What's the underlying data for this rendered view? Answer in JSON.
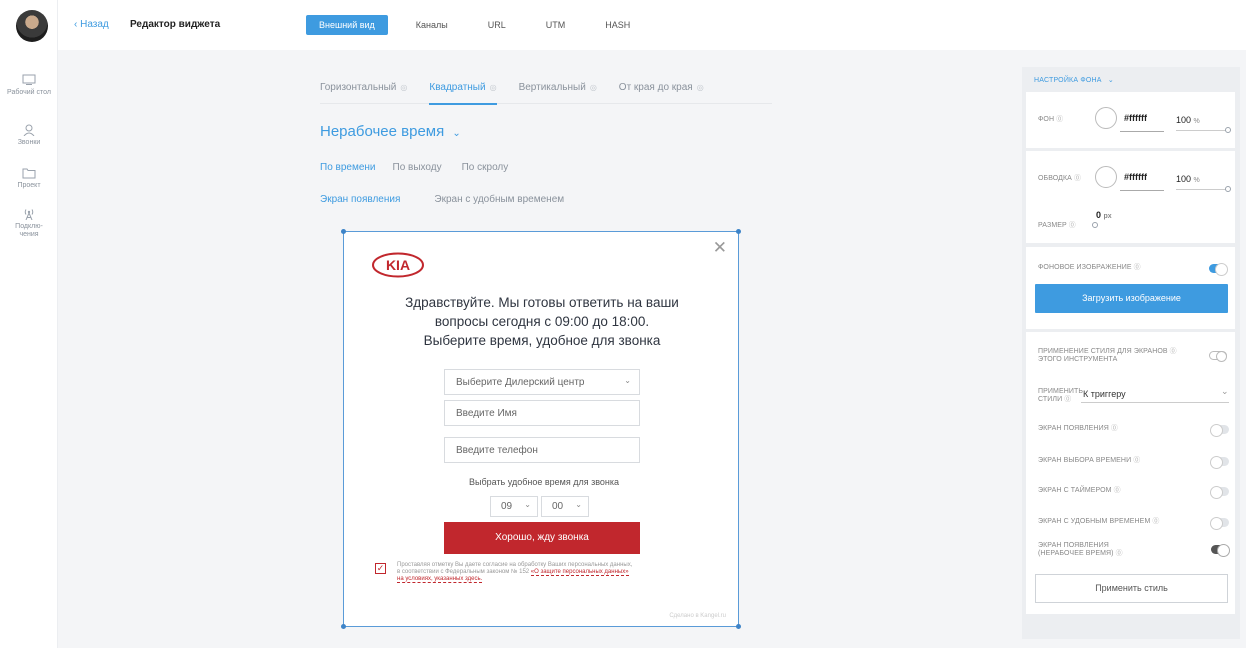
{
  "sidebar": {
    "items": [
      {
        "label": "Рабочий стол",
        "icon": "desktop-icon"
      },
      {
        "label": "Звонки",
        "icon": "person-icon"
      },
      {
        "label": "Проект",
        "icon": "folder-icon"
      },
      {
        "label": "Подклю-чения",
        "icon": "antenna-icon"
      }
    ]
  },
  "topbar": {
    "back": "‹ Назад",
    "title": "Редактор виджета",
    "tabs": [
      "Внешний вид",
      "Каналы",
      "URL",
      "UTM",
      "HASH"
    ]
  },
  "main": {
    "size_tabs": [
      "Горизонтальный",
      "Квадратный",
      "Вертикальный",
      "От края до края"
    ],
    "screen_title": "Нерабочее время",
    "trigger_tabs": [
      "По времени",
      "По выходу",
      "По скролу"
    ],
    "screen_tabs": [
      "Экран появления",
      "Экран с удобным временем"
    ]
  },
  "widget": {
    "brand_logo": "KIA",
    "headline_1": "Здравствуйте. Мы готовы ответить на ваши",
    "headline_2": "вопросы сегодня с 09:00 до 18:00.",
    "headline_3": "Выберите время, удобное для звонка",
    "dealer_placeholder": "Выберите Дилерский центр",
    "name_placeholder": "Введите Имя",
    "phone_placeholder": "Введите телефон",
    "time_label": "Выбрать удобное время для звонка",
    "hour": "09",
    "minute": "00",
    "cta": "Хорошо, жду звонка",
    "consent_1": "Проставляя отметку Вы даете согласие на обработку Ваших персональных данных,",
    "consent_2": "в соответствии с Федеральным законом № 152",
    "consent_link_1": "«О защите персональных данных»",
    "consent_link_2": "на условиях, указанных здесь.",
    "made_by": "Сделано в Kangel.ru",
    "accent_color": "#c1272d"
  },
  "panel": {
    "header": "НАСТРОЙКА ФОНА",
    "bg_label": "ФОН",
    "bg_hex": "#ffffff",
    "bg_opacity": "100",
    "border_label": "ОБВОДКА",
    "border_hex": "#ffffff",
    "border_opacity": "100",
    "size_label": "РАЗМЕР",
    "size_value": "0",
    "size_unit": "px",
    "percent": "%",
    "bg_image_label": "ФОНОВОЕ ИЗОБРАЖЕНИЕ",
    "upload": "Загрузить изображение",
    "apply_style_1": "ПРИМЕНЕНИЕ СТИЛЯ ДЛЯ ЭКРАНОВ",
    "apply_style_2": "ЭТОГО ИНСТРУМЕНТА",
    "apply_to_1": "ПРИМЕНИТЬ",
    "apply_to_2": "СТИЛИ",
    "apply_to_value": "К триггеру",
    "screens": [
      {
        "label": "ЭКРАН ПОЯВЛЕНИЯ",
        "on": false
      },
      {
        "label": "ЭКРАН ВЫБОРА ВРЕМЕНИ",
        "on": false
      },
      {
        "label": "ЭКРАН С ТАЙМЕРОМ",
        "on": false
      },
      {
        "label": "ЭКРАН С УДОБНЫМ ВРЕМЕНЕМ",
        "on": false
      }
    ],
    "offhours_1": "ЭКРАН ПОЯВЛЕНИЯ",
    "offhours_2": "(НЕРАБОЧЕЕ ВРЕМЯ)",
    "apply_button": "Применить стиль"
  },
  "colors": {
    "accent": "#3e9be0",
    "brand_red": "#c1272d"
  }
}
